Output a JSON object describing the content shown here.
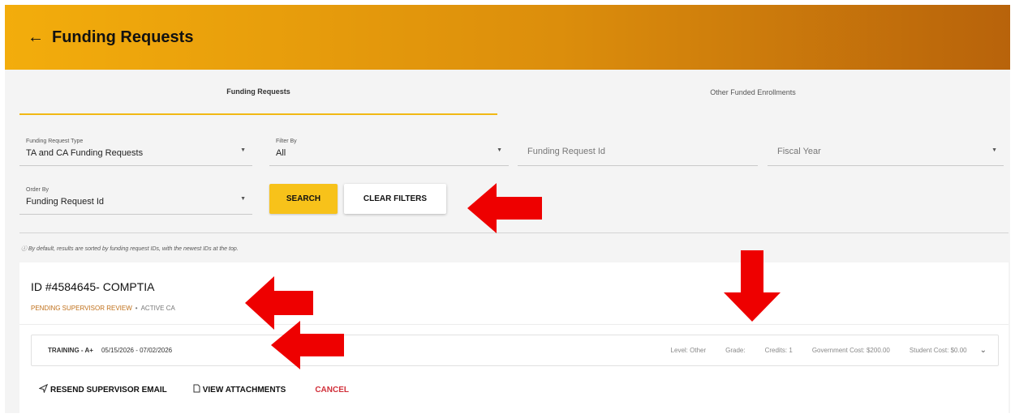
{
  "header": {
    "title": "Funding Requests",
    "back_icon": "arrow-left-icon"
  },
  "tabs": [
    {
      "label": "Funding Requests",
      "active": true
    },
    {
      "label": "Other Funded Enrollments",
      "active": false
    }
  ],
  "filters": {
    "funding_request_type": {
      "label": "Funding Request Type",
      "value": "TA and CA Funding Requests"
    },
    "filter_by": {
      "label": "Filter By",
      "value": "All"
    },
    "funding_request_id": {
      "placeholder": "Funding Request Id"
    },
    "fiscal_year": {
      "placeholder": "Fiscal Year"
    },
    "order_by": {
      "label": "Order By",
      "value": "Funding Request Id"
    }
  },
  "buttons": {
    "search": "SEARCH",
    "clear_filters": "CLEAR FILTERS"
  },
  "info_text": "ⓘ By default, results are sorted by funding request IDs, with the newest IDs at the top.",
  "request": {
    "title": "ID #4584645- COMPTIA",
    "status": "PENDING SUPERVISOR REVIEW",
    "separator": "•",
    "secondary_status": "ACTIVE CA",
    "training": {
      "name": "TRAINING - A+",
      "dates": "05/15/2026 - 07/02/2026",
      "level": "Level: Other",
      "grade": "Grade:",
      "credits": "Credits: 1",
      "government_cost": "Government Cost: $200.00",
      "student_cost": "Student Cost: $0.00"
    },
    "actions": {
      "resend": "RESEND SUPERVISOR EMAIL",
      "view_attachments": "VIEW ATTACHMENTS",
      "cancel": "CANCEL"
    }
  },
  "colors": {
    "header_gradient_start": "#f3ad0c",
    "header_gradient_end": "#b8630b",
    "search_button": "#f7c21a",
    "status_text": "#c0701a",
    "cancel_text": "#d1303a",
    "annotation_arrow": "#ee0000"
  }
}
